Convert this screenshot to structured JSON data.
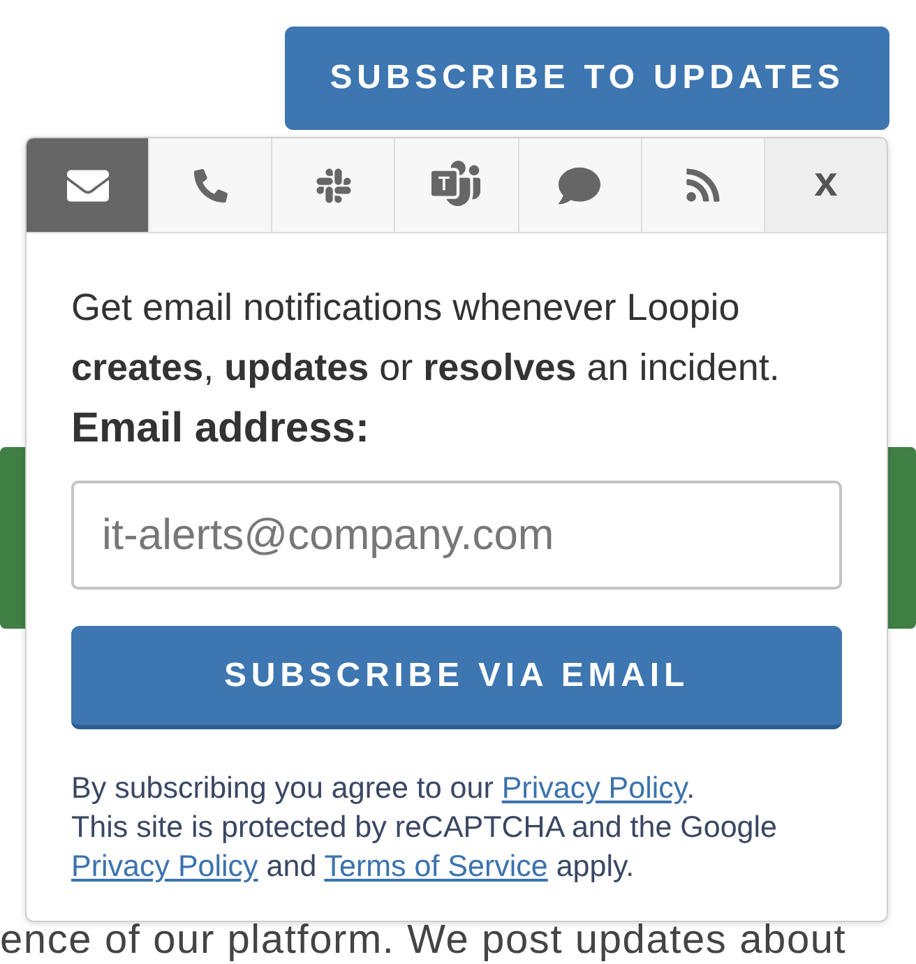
{
  "header": {
    "subscribe_button": "SUBSCRIBE TO UPDATES"
  },
  "popup": {
    "tabs": [
      {
        "kind": "email",
        "selected": true
      },
      {
        "kind": "phone",
        "selected": false
      },
      {
        "kind": "slack",
        "selected": false
      },
      {
        "kind": "teams",
        "selected": false
      },
      {
        "kind": "chat",
        "selected": false
      },
      {
        "kind": "rss",
        "selected": false
      }
    ],
    "close_label": "x",
    "intro": "Get email notifications whenever Loopio **creates**, **updates** or **resolves** an incident.",
    "email_label": "Email address:",
    "email_field": {
      "placeholder": "it-alerts@company.com"
    },
    "submit_button": "SUBSCRIBE VIA EMAIL",
    "legal": [
      [
        {
          "kind": "text",
          "text": "By subscribing you agree to our "
        },
        {
          "kind": "link",
          "text": "Privacy Policy"
        },
        {
          "kind": "text",
          "text": "."
        }
      ],
      [
        {
          "kind": "text",
          "text": "This site is protected by reCAPTCHA and the Google "
        },
        {
          "kind": "link",
          "text": "Privacy Policy"
        },
        {
          "kind": "text",
          "text": " and "
        },
        {
          "kind": "link",
          "text": "Terms of Service"
        },
        {
          "kind": "text",
          "text": " apply."
        }
      ]
    ]
  },
  "background_text": "ence of our platform. We post updates about"
}
